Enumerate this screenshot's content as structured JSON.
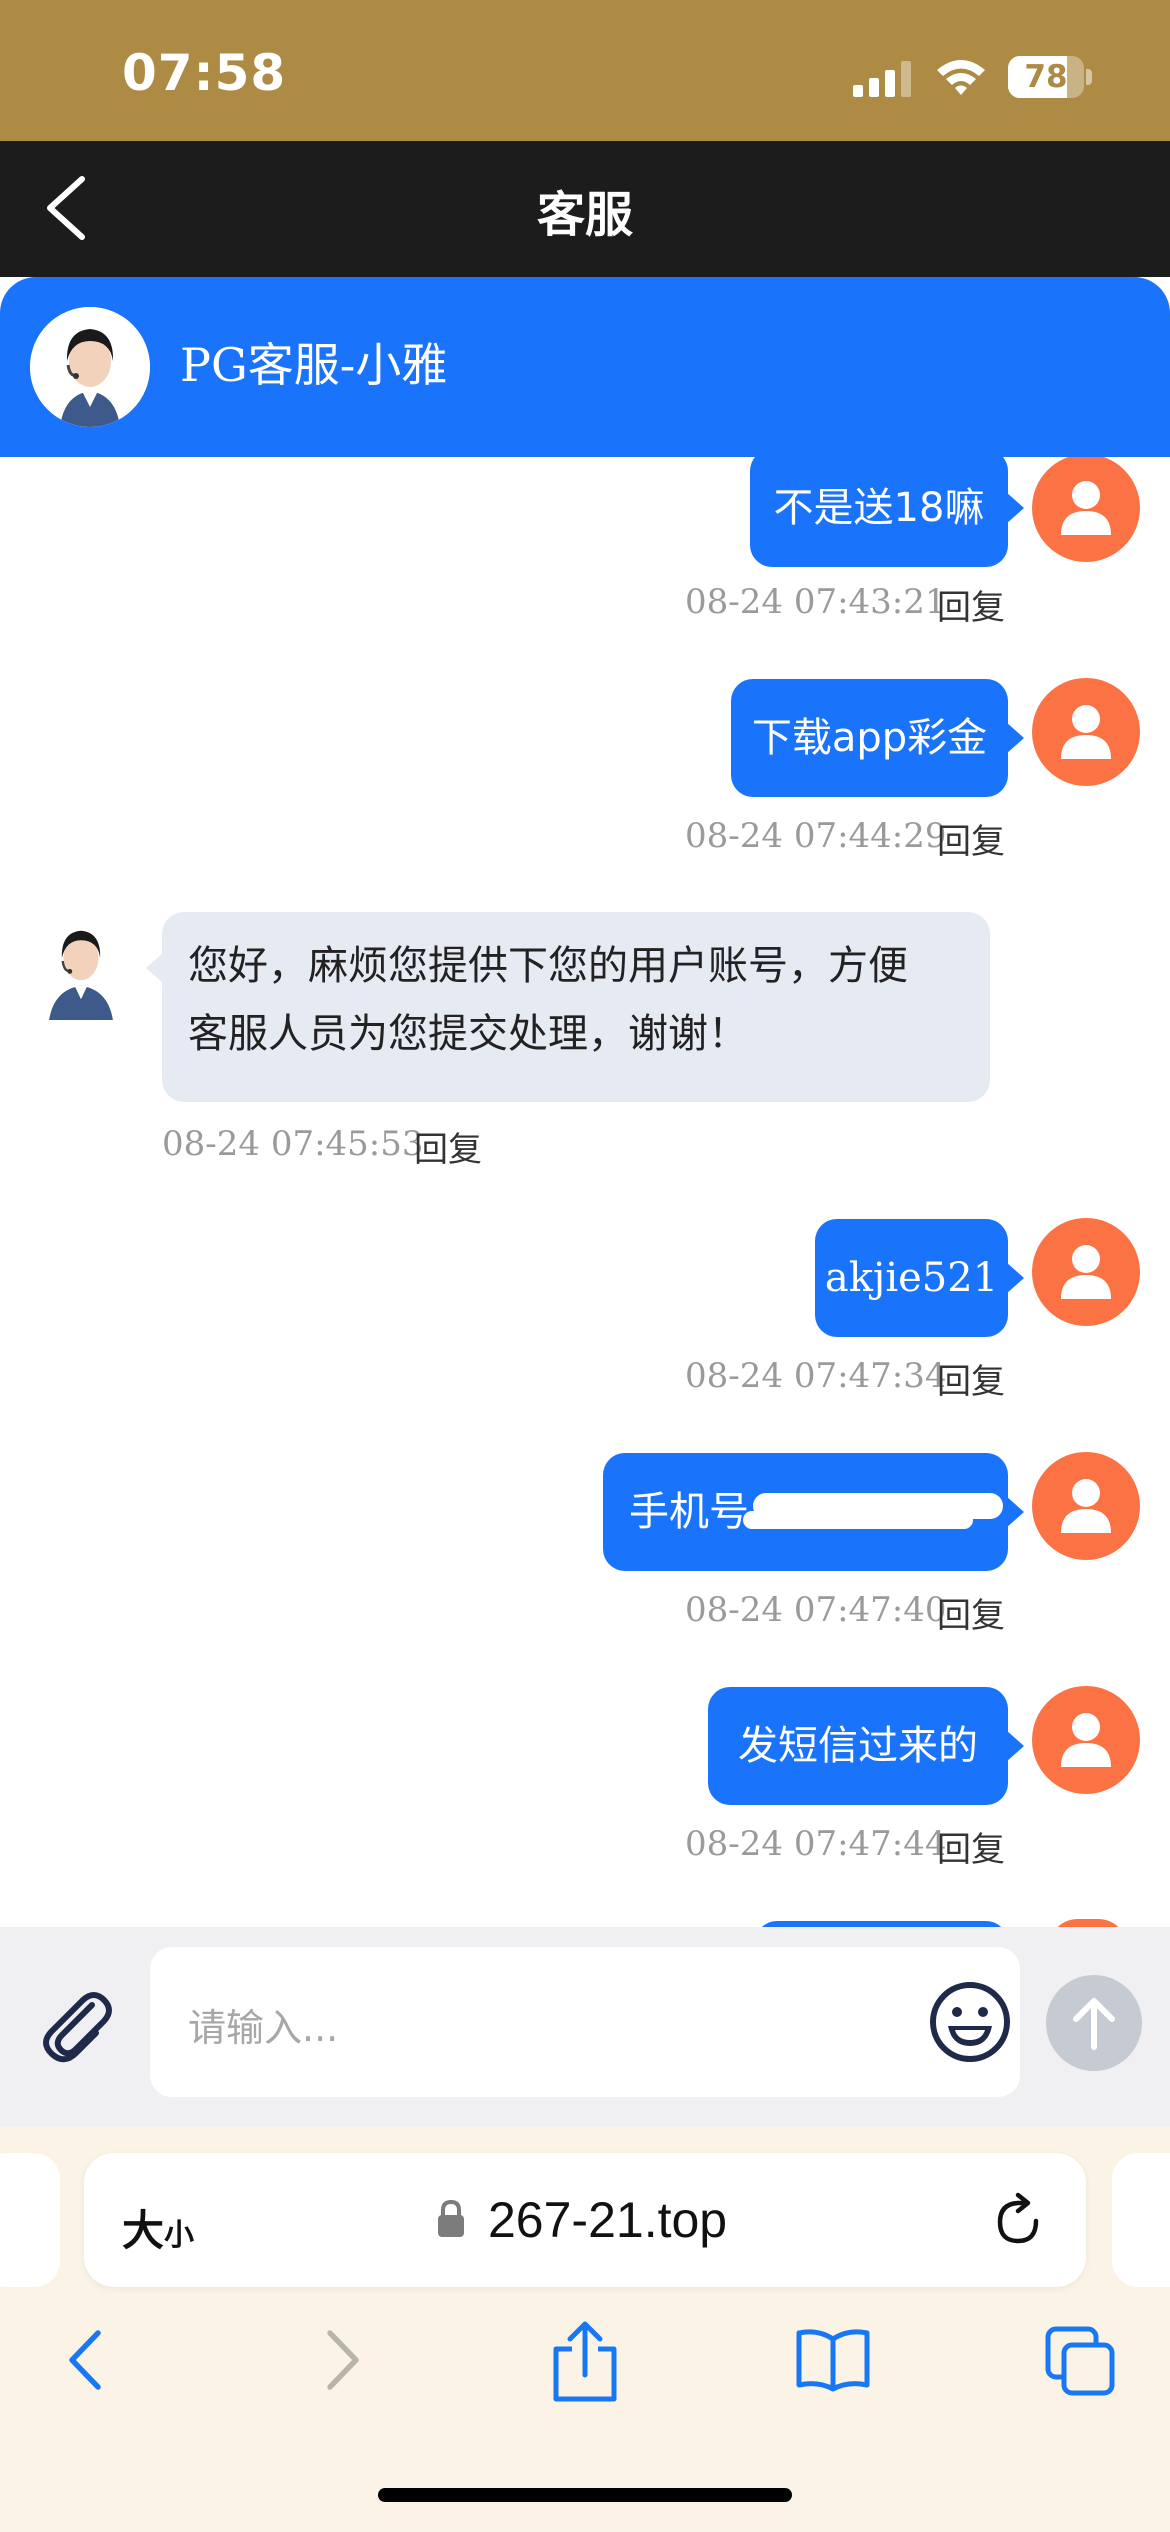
{
  "status_bar": {
    "time": "07:58",
    "battery_level": "78",
    "icons": [
      "signal-icon",
      "wifi-icon",
      "battery-icon"
    ]
  },
  "nav": {
    "title": "客服",
    "back_icon": "chevron-left-icon"
  },
  "agent": {
    "name": "PG客服-小雅",
    "avatar": "agent-avatar"
  },
  "messages": [
    {
      "direction": "out",
      "text": "不是送18嘛",
      "time": "08-24 07:43:21",
      "reply": "回复"
    },
    {
      "direction": "out",
      "text": "下载app彩金",
      "time": "08-24 07:44:29",
      "reply": "回复"
    },
    {
      "direction": "in",
      "text_line1": "您好，麻烦您提供下您的用户账号，方便",
      "text_line2": "客服人员为您提交处理，谢谢！",
      "time": "08-24 07:45:53",
      "reply": "回复"
    },
    {
      "direction": "out",
      "text": "akjie521",
      "time": "08-24 07:47:34",
      "reply": "回复"
    },
    {
      "direction": "out",
      "text": "手机号",
      "time": "08-24 07:47:40",
      "reply": "回复"
    },
    {
      "direction": "out",
      "text": "发短信过来的",
      "time": "08-24 07:47:44",
      "reply": "回复"
    }
  ],
  "input": {
    "placeholder": "请输入...",
    "icons": [
      "paperclip-icon",
      "emoji-icon",
      "send-arrow-icon"
    ]
  },
  "browser": {
    "size_label_big": "大",
    "size_label_small": "小",
    "url": "267-21.top",
    "icons": [
      "lock-icon",
      "reload-icon",
      "back-arrow-icon",
      "forward-arrow-icon",
      "share-icon",
      "bookmarks-icon",
      "tabs-icon"
    ]
  },
  "colors": {
    "status_bar": "#ad8b44",
    "nav": "#1c1c1c",
    "brand_blue": "#1a73fb",
    "user_avatar": "#fb7345",
    "incoming_bubble": "#e6ebf3",
    "safari_toolbar": "#fbf4e6"
  }
}
